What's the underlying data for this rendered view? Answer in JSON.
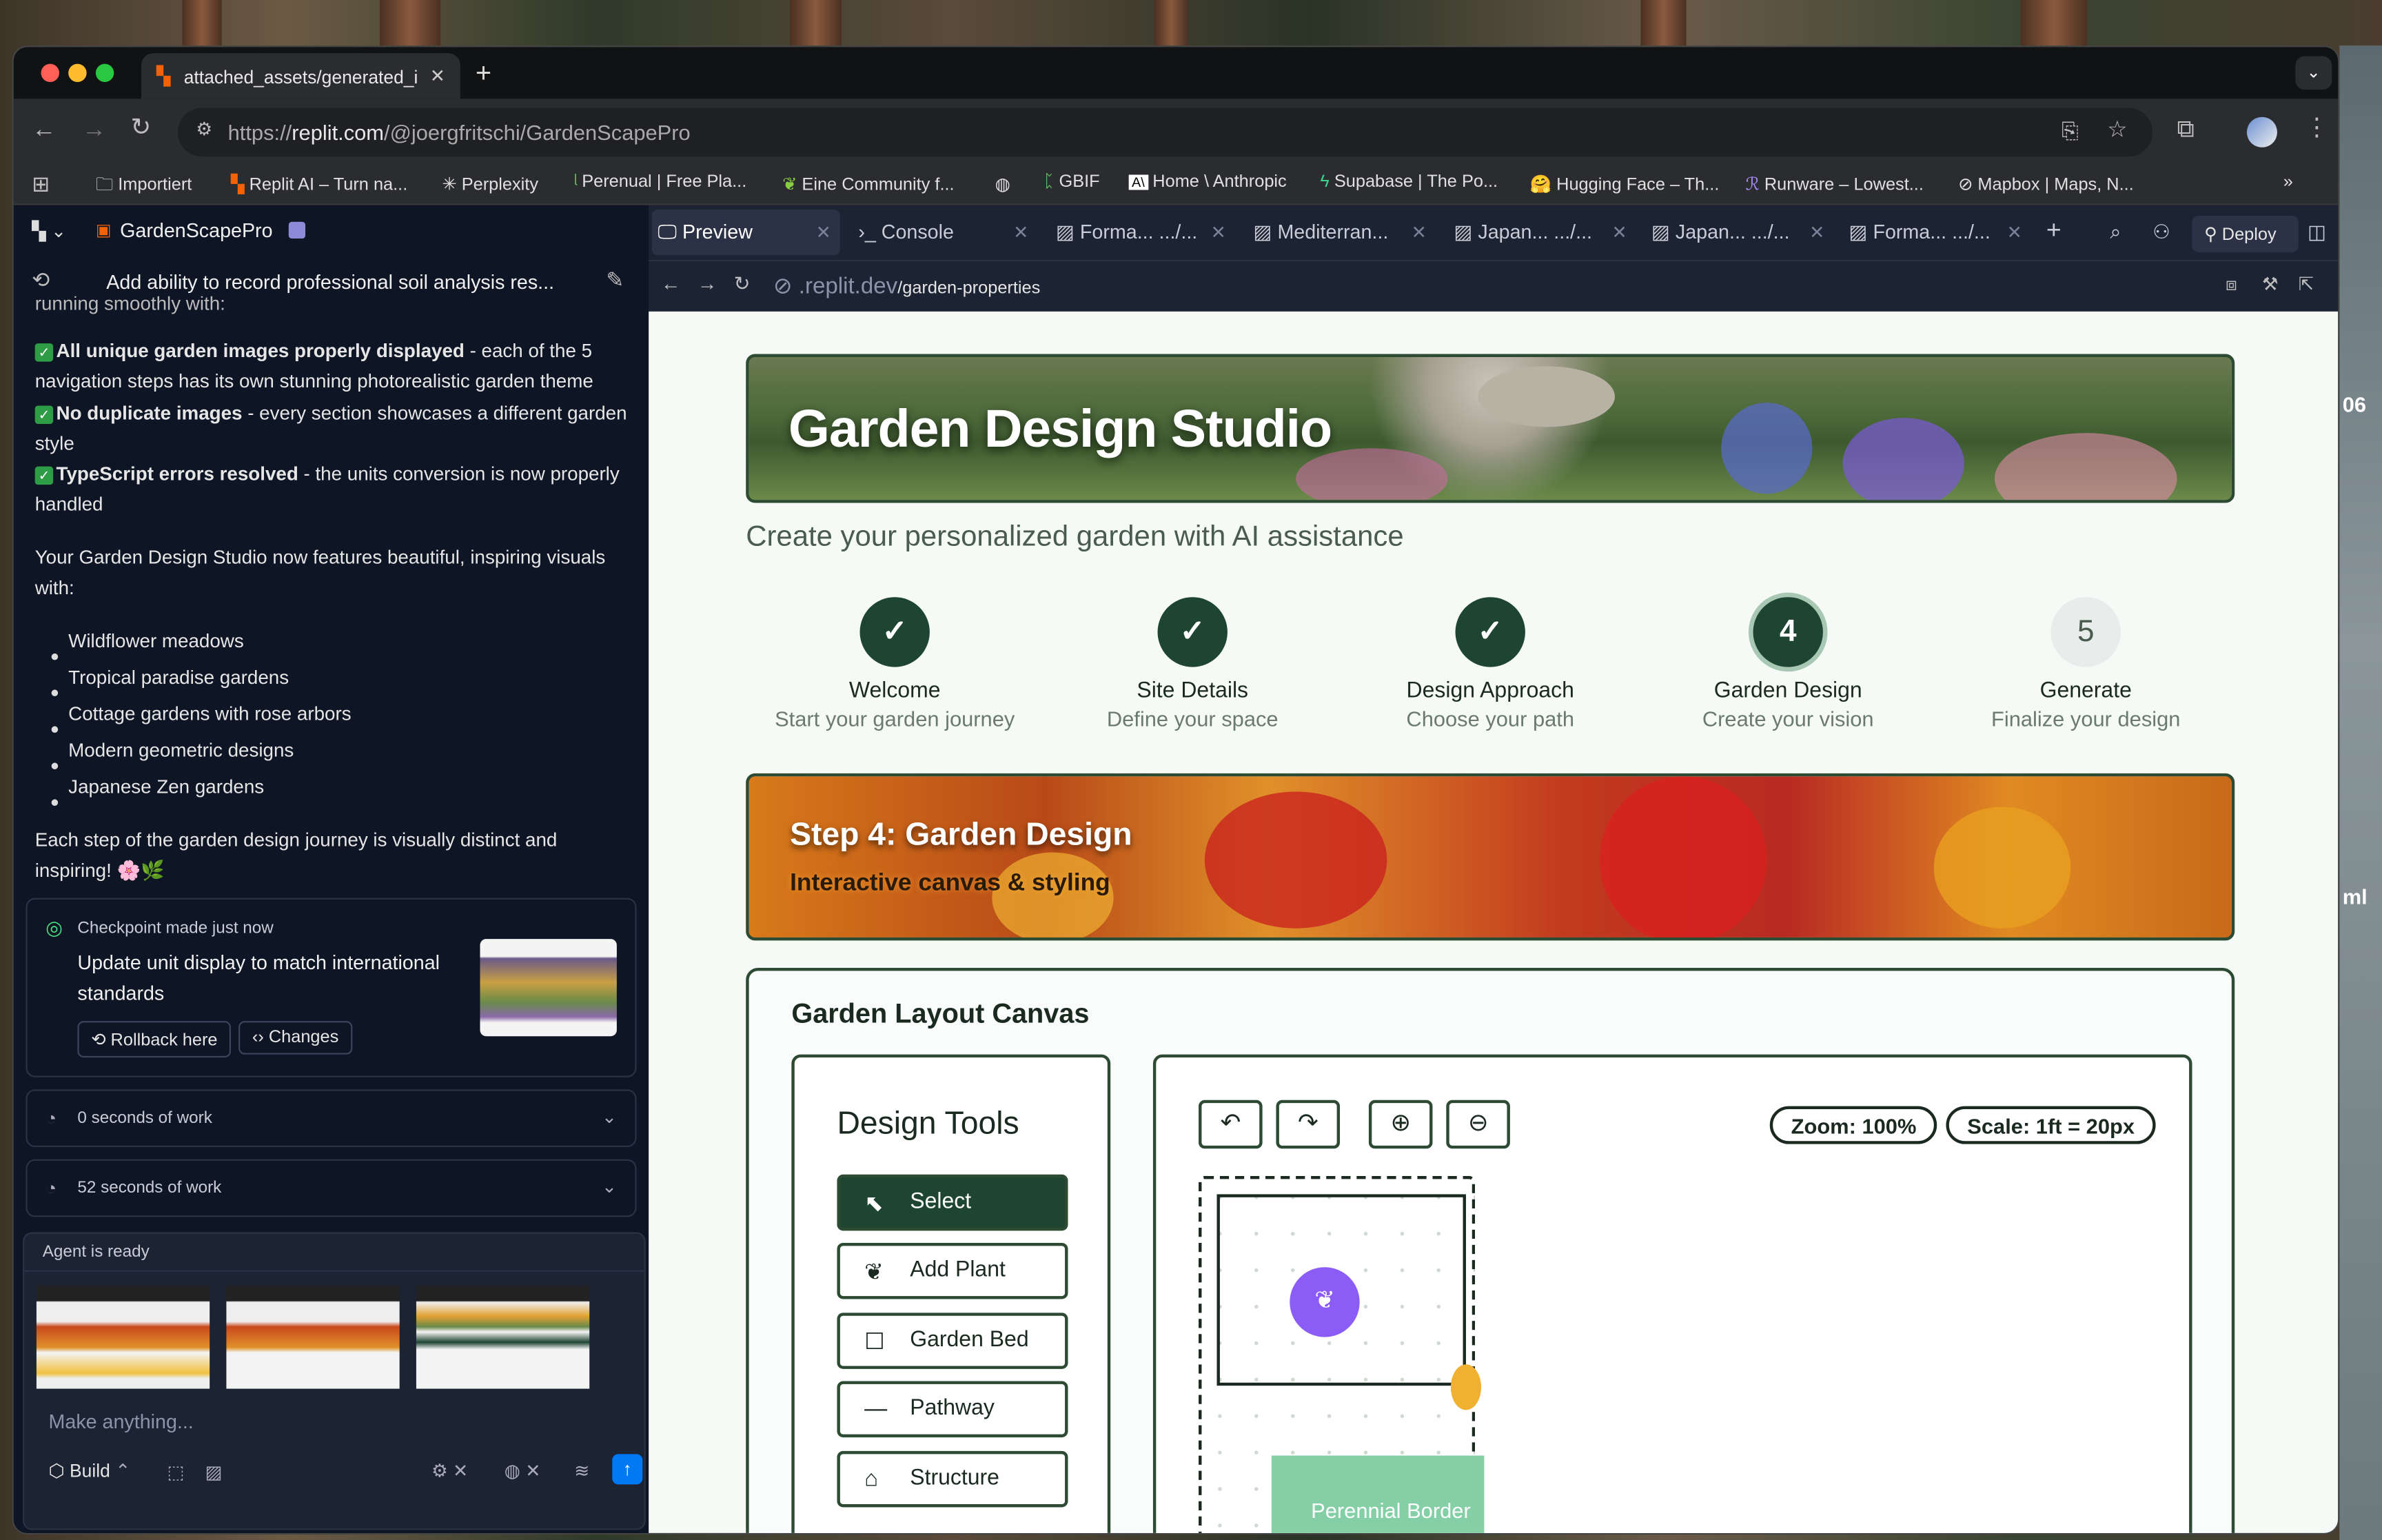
{
  "browser": {
    "tab_title": "attached_assets/generated_i",
    "url_prefix": "https://",
    "url_domain": "replit.com",
    "url_path": "/@joergfritschi/GardenScapePro",
    "bookmarks": [
      "Importiert",
      "Replit AI – Turn na...",
      "Perplexity",
      "Perenual | Free Pla...",
      "Eine Community f...",
      "GBIF",
      "Home \\ Anthropic",
      "Supabase | The Po...",
      "Hugging Face – Th...",
      "Runware – Lowest...",
      "Mapbox | Maps, N..."
    ]
  },
  "desktop": {
    "edge_text_1": "06",
    "edge_text_2": "ml"
  },
  "replit": {
    "project_name": "GardenScapePro",
    "thread_title": "Add ability to record professional soil analysis res...",
    "chat": {
      "cut_line": "running smoothly with:",
      "checks": [
        {
          "bold": "All unique garden images properly displayed",
          "rest": " - each of the 5 navigation steps has its own stunning photorealistic garden theme"
        },
        {
          "bold": "No duplicate images",
          "rest": " - every section showcases a different garden style"
        },
        {
          "bold": "TypeScript errors resolved",
          "rest": " - the units conversion is now properly handled"
        }
      ],
      "intro": "Your Garden Design Studio now features beautiful, inspiring visuals with:",
      "bullets": [
        "Wildflower meadows",
        "Tropical paradise gardens",
        "Cottage gardens with rose arbors",
        "Modern geometric designs",
        "Japanese Zen gardens"
      ],
      "closing": "Each step of the garden design journey is visually distinct and inspiring! 🌸🌿"
    },
    "checkpoint": {
      "label": "Checkpoint made just now",
      "title": "Update unit display to match international standards",
      "rollback": "Rollback here",
      "changes": "Changes"
    },
    "work": [
      "0 seconds of work",
      "52 seconds of work"
    ],
    "agent_status": "Agent is ready",
    "input_placeholder": "Make anything...",
    "build_label": "Build",
    "tabs": [
      "Preview",
      "Console",
      "Forma... .../...",
      "Mediterran...",
      "Japan... .../...",
      "Japan... .../...",
      "Forma... .../..."
    ],
    "deploy_label": "Deploy",
    "preview_url_domain": ".replit.dev",
    "preview_url_path": "/garden-properties"
  },
  "app": {
    "title": "Garden Design Studio",
    "subtitle": "Create your personalized garden with AI assistance",
    "steps": [
      {
        "mark": "✓",
        "title": "Welcome",
        "sub": "Start your garden journey"
      },
      {
        "mark": "✓",
        "title": "Site Details",
        "sub": "Define your space"
      },
      {
        "mark": "✓",
        "title": "Design Approach",
        "sub": "Choose your path"
      },
      {
        "mark": "4",
        "title": "Garden Design",
        "sub": "Create your vision"
      },
      {
        "mark": "5",
        "title": "Generate",
        "sub": "Finalize your design"
      }
    ],
    "step_banner_title": "Step 4: Garden Design",
    "step_banner_sub": "Interactive canvas & styling",
    "canvas_title": "Garden Layout Canvas",
    "tools_title": "Design Tools",
    "tools": [
      "Select",
      "Add Plant",
      "Garden Bed",
      "Pathway",
      "Structure"
    ],
    "zoom": "Zoom: 100%",
    "scale": "Scale: 1ft = 20px",
    "perennial_label": "Perennial Border"
  },
  "colors": {
    "accent_green": "#1e4532",
    "plant_purple": "#8b5cf6",
    "perennial_green": "#84cfa6",
    "replit_bg": "#0e1525"
  }
}
